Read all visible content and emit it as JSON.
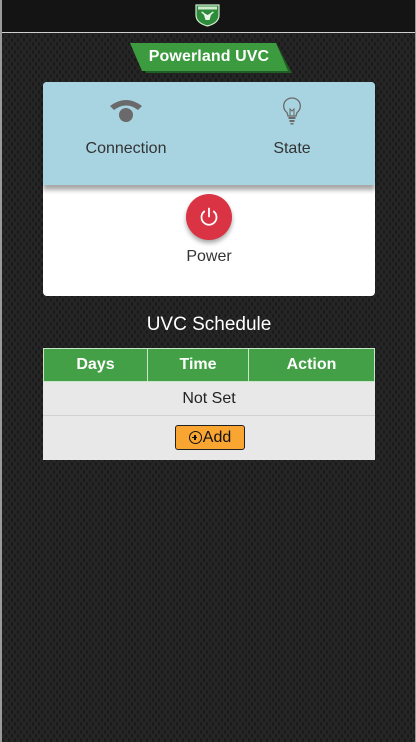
{
  "header": {
    "logo_icon": "bull-shield-logo-icon"
  },
  "title_ribbon": {
    "text": "Powerland UVC",
    "color": "#3c9a3f"
  },
  "status": {
    "connection": {
      "label": "Connection",
      "icon": "wifi-icon"
    },
    "state": {
      "label": "State",
      "icon": "lightbulb-icon"
    }
  },
  "power": {
    "label": "Power",
    "icon": "power-icon",
    "color": "#d93344"
  },
  "schedule": {
    "title": "UVC Schedule",
    "columns": [
      "Days",
      "Time",
      "Action"
    ],
    "empty_text": "Not Set",
    "add_label": "Add",
    "header_color": "#43a047",
    "add_button_color": "#f9a531"
  }
}
